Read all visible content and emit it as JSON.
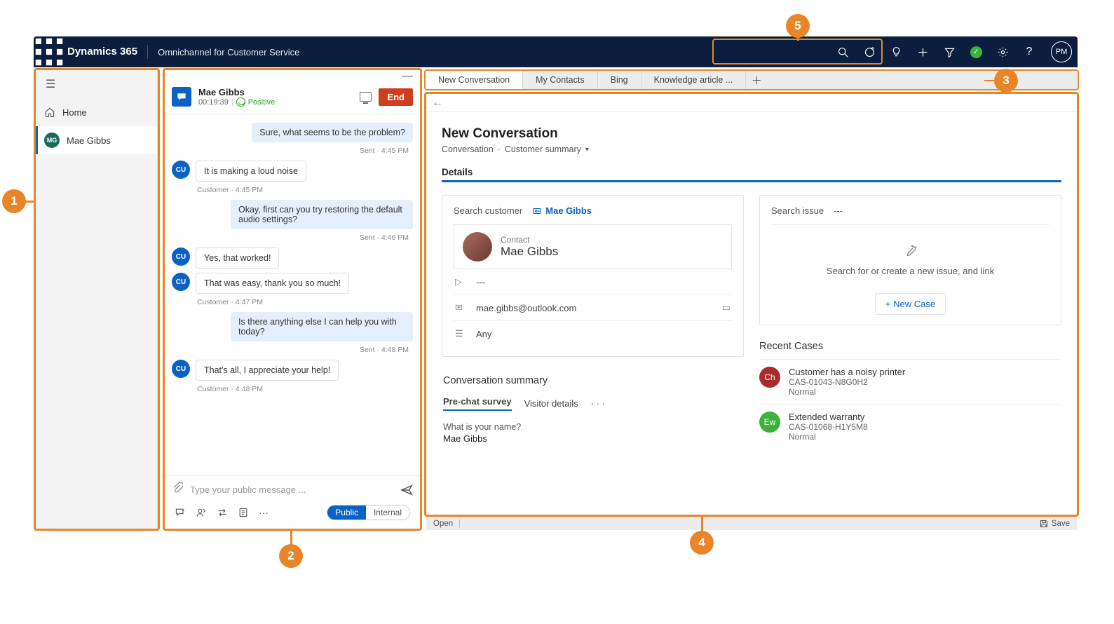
{
  "nav": {
    "brand": "Dynamics 365",
    "app": "Omnichannel for Customer Service",
    "avatar": "PM"
  },
  "sidebar": {
    "home": "Home",
    "session": {
      "initials": "MG",
      "name": "Mae Gibbs"
    }
  },
  "conv": {
    "name": "Mae Gibbs",
    "timer": "00:19:39",
    "sentiment": "Positive",
    "end": "End",
    "messages": [
      {
        "from": "agent",
        "text": "Sure, what seems to be the problem?",
        "meta": "Sent · 4:45 PM"
      },
      {
        "from": "cust",
        "text": "It is making a loud noise",
        "meta": "Customer · 4:45 PM"
      },
      {
        "from": "agent",
        "text": "Okay, first can you try restoring the default audio settings?",
        "meta": "Sent · 4:46 PM"
      },
      {
        "from": "cust",
        "text": "Yes, that worked!",
        "meta": ""
      },
      {
        "from": "cust",
        "text": "That was easy, thank you so much!",
        "meta": "Customer · 4:47 PM"
      },
      {
        "from": "agent",
        "text": "Is there anything else I can help you with today?",
        "meta": "Sent · 4:48 PM"
      },
      {
        "from": "cust",
        "text": "That's all, I appreciate your help!",
        "meta": "Customer · 4:48 PM"
      }
    ],
    "compose_placeholder": "Type your public message ...",
    "pill": {
      "public": "Public",
      "internal": "Internal"
    }
  },
  "tabs": [
    "New Conversation",
    "My Contacts",
    "Bing",
    "Knowledge article ..."
  ],
  "form": {
    "title": "New Conversation",
    "bc_entity": "Conversation",
    "bc_view": "Customer summary",
    "tab": "Details",
    "customer_card": {
      "search_label": "Search customer",
      "linked_name": "Mae Gibbs",
      "contact_label": "Contact",
      "contact_name": "Mae Gibbs",
      "phone": "---",
      "email": "mae.gibbs@outlook.com",
      "pref": "Any"
    },
    "issue_card": {
      "search_label": "Search issue",
      "value": "---",
      "text": "Search for or create a new issue, and link",
      "button": "+ New Case"
    },
    "recent": {
      "title": "Recent Cases",
      "items": [
        {
          "badge": "Ch",
          "color": "#a82c2c",
          "name": "Customer has a noisy printer",
          "caseid": "CAS-01043-N8G0H2",
          "priority": "Normal"
        },
        {
          "badge": "Ew",
          "color": "#3bb33b",
          "name": "Extended warranty",
          "caseid": "CAS-01068-H1Y5M8",
          "priority": "Normal"
        }
      ]
    },
    "conv_summary": {
      "title": "Conversation summary",
      "tabs": {
        "pre": "Pre-chat survey",
        "visitor": "Visitor details",
        "more": "· · ·"
      },
      "q": "What is your name?",
      "a": "Mae Gibbs"
    }
  },
  "footer": {
    "open": "Open",
    "save": "Save"
  },
  "callouts": {
    "c1": "1",
    "c2": "2",
    "c3": "3",
    "c4": "4",
    "c5": "5"
  }
}
